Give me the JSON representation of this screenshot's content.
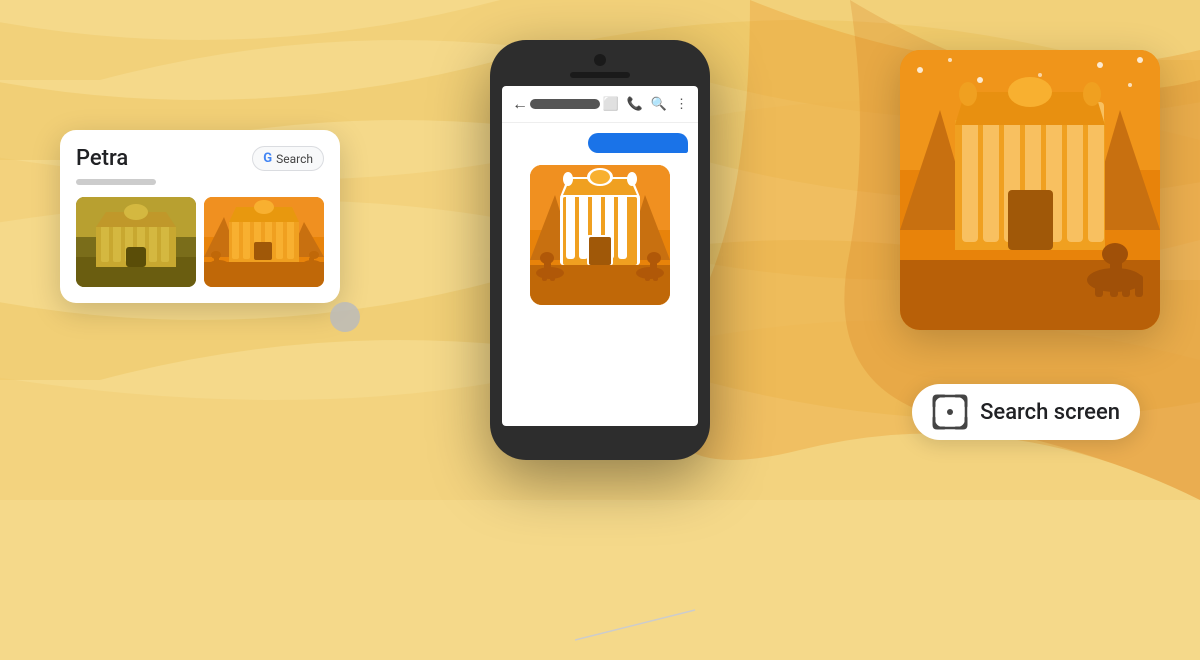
{
  "background": {
    "color": "#f5d98a"
  },
  "searchCard": {
    "title": "Petra",
    "subtitle_placeholder": "",
    "googleBtn": {
      "label": "Search",
      "gColors": [
        "#4285F4",
        "#EA4335",
        "#FBBC05",
        "#34A853"
      ]
    },
    "images": [
      {
        "bg": "#8a7a2a",
        "label": "petra-thumb-1"
      },
      {
        "bg": "#e8950a",
        "label": "petra-thumb-2"
      }
    ]
  },
  "phone": {
    "contactName": "",
    "icons": [
      "video",
      "phone",
      "search",
      "more"
    ]
  },
  "searchScreenBadge": {
    "label": "Search screen",
    "iconName": "lens-icon"
  }
}
